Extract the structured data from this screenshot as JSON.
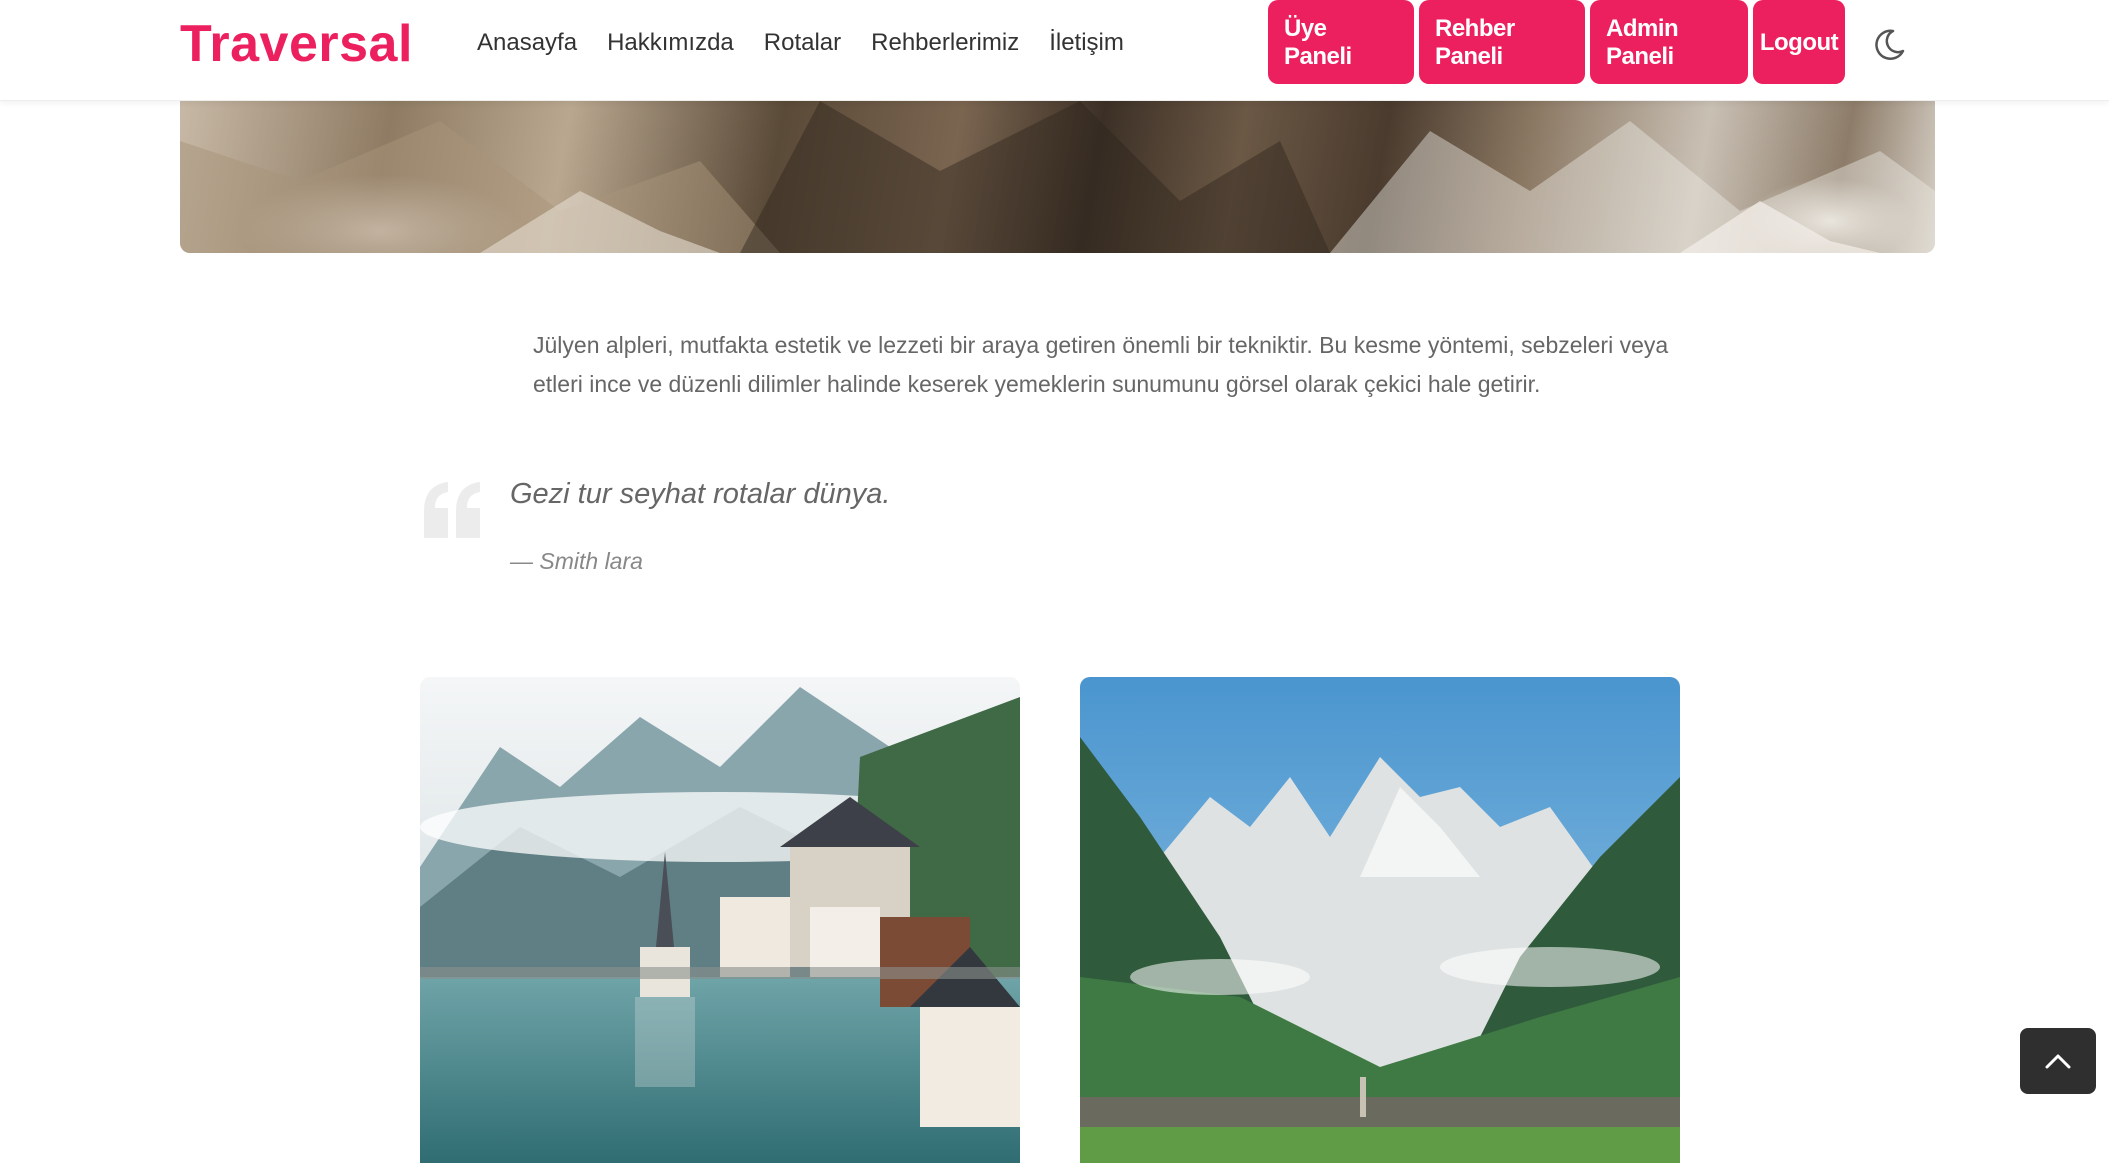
{
  "brand": {
    "name": "Traversal",
    "color": "#ec1f5f"
  },
  "nav": {
    "items": [
      "Anasayfa",
      "Hakkımızda",
      "Rotalar",
      "Rehberlerimiz",
      "İletişim"
    ]
  },
  "panels": {
    "uye": "Üye Paneli",
    "rehber": "Rehber Paneli",
    "admin": "Admin Paneli",
    "logout": "Logout"
  },
  "icons": {
    "theme_toggle": "moon-icon",
    "quote": "quote-icon",
    "scroll_top": "chevron-up-icon"
  },
  "article": {
    "intro": "Jülyen alpleri, mutfakta estetik ve lezzeti bir araya getiren önemli bir tekniktir. Bu kesme yöntemi, sebzeleri veya etleri ince ve düzenli dilimler halinde keserek yemeklerin sunumunu görsel olarak çekici hale getirir.",
    "quote": "Gezi tur seyhat rotalar dünya.",
    "quote_author": "— Smith lara"
  },
  "images": {
    "left": "lakeside-village-photo",
    "right": "alpine-valley-photo"
  }
}
